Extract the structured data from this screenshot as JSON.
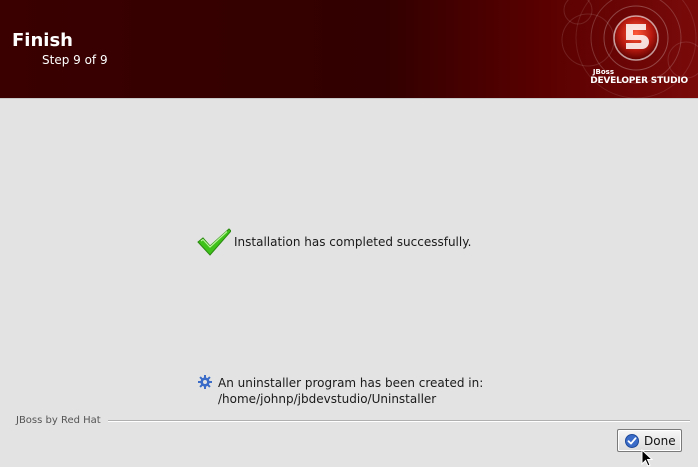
{
  "header": {
    "title": "Finish",
    "step": "Step 9 of 9",
    "brand_small": "JBoss",
    "brand_main": "DEVELOPER STUDIO"
  },
  "main": {
    "success_message": "Installation has completed successfully.",
    "uninstaller_line1": "An uninstaller program has been created in:",
    "uninstaller_line2": "/home/johnp/jbdevstudio/Uninstaller"
  },
  "footer": {
    "vendor_label": "JBoss by Red Hat",
    "done_label": "Done"
  },
  "icons": {
    "success": "check-icon",
    "uninstaller": "gear-icon",
    "done": "check-circle-icon",
    "logo": "jboss-logo-icon",
    "cursor": "mouse-pointer-icon"
  },
  "colors": {
    "header_bg": "#3a0000",
    "header_accent": "#7a0a0a",
    "window_bg": "#e3e3e3",
    "check_green": "#3fc21a",
    "info_blue": "#3a6cc8"
  }
}
